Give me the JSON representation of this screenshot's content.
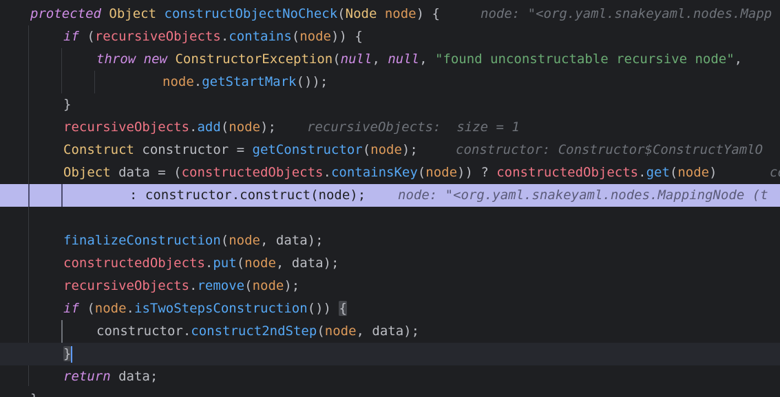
{
  "editor": {
    "lines": [
      {
        "tokens": [
          {
            "t": "protected",
            "c": "tok-kw"
          },
          {
            "t": " "
          },
          {
            "t": "Object",
            "c": "tok-type"
          },
          {
            "t": " "
          },
          {
            "t": "constructObjectNoCheck",
            "c": "tok-method"
          },
          {
            "t": "("
          },
          {
            "t": "Node",
            "c": "tok-type"
          },
          {
            "t": " "
          },
          {
            "t": "node",
            "c": "tok-param"
          },
          {
            "t": ") {"
          }
        ],
        "hint": "node: \"<org.yaml.snakeyaml.nodes.Mapp"
      },
      {
        "tokens": [
          {
            "t": "if",
            "c": "tok-kw"
          },
          {
            "t": " ("
          },
          {
            "t": "recursiveObjects",
            "c": "tok-field"
          },
          {
            "t": "."
          },
          {
            "t": "contains",
            "c": "tok-method"
          },
          {
            "t": "("
          },
          {
            "t": "node",
            "c": "tok-param"
          },
          {
            "t": ")) {"
          }
        ]
      },
      {
        "tokens": [
          {
            "t": "throw",
            "c": "tok-kw"
          },
          {
            "t": " "
          },
          {
            "t": "new",
            "c": "tok-kw"
          },
          {
            "t": " "
          },
          {
            "t": "ConstructorException",
            "c": "tok-type"
          },
          {
            "t": "("
          },
          {
            "t": "null",
            "c": "tok-kw"
          },
          {
            "t": ", "
          },
          {
            "t": "null",
            "c": "tok-kw"
          },
          {
            "t": ", "
          },
          {
            "t": "\"found unconstructable recursive node\"",
            "c": "tok-string"
          },
          {
            "t": ","
          }
        ]
      },
      {
        "tokens": [
          {
            "t": "node",
            "c": "tok-param"
          },
          {
            "t": "."
          },
          {
            "t": "getStartMark",
            "c": "tok-method"
          },
          {
            "t": "());"
          }
        ]
      },
      {
        "tokens": [
          {
            "t": "}"
          }
        ]
      },
      {
        "tokens": [
          {
            "t": "recursiveObjects",
            "c": "tok-field"
          },
          {
            "t": "."
          },
          {
            "t": "add",
            "c": "tok-method"
          },
          {
            "t": "("
          },
          {
            "t": "node",
            "c": "tok-param"
          },
          {
            "t": ");"
          }
        ],
        "hint": "recursiveObjects:  size = 1"
      },
      {
        "tokens": [
          {
            "t": "Construct",
            "c": "tok-type"
          },
          {
            "t": " constructor = "
          },
          {
            "t": "getConstructor",
            "c": "tok-method"
          },
          {
            "t": "("
          },
          {
            "t": "node",
            "c": "tok-param"
          },
          {
            "t": ");"
          }
        ],
        "hint": "constructor: Constructor$ConstructYamlO"
      },
      {
        "tokens": [
          {
            "t": "Object",
            "c": "tok-type"
          },
          {
            "t": " data = ("
          },
          {
            "t": "constructedObjects",
            "c": "tok-field"
          },
          {
            "t": "."
          },
          {
            "t": "containsKey",
            "c": "tok-method"
          },
          {
            "t": "("
          },
          {
            "t": "node",
            "c": "tok-param"
          },
          {
            "t": ")) ? "
          },
          {
            "t": "constructedObjects",
            "c": "tok-field"
          },
          {
            "t": "."
          },
          {
            "t": "get",
            "c": "tok-method"
          },
          {
            "t": "("
          },
          {
            "t": "node",
            "c": "tok-param"
          },
          {
            "t": ")"
          }
        ],
        "hint": "co"
      },
      {
        "tokens": [
          {
            "t": ": constructor.construct(node);"
          }
        ],
        "hint": "node: \"<org.yaml.snakeyaml.nodes.MappingNode (t"
      },
      {
        "tokens": []
      },
      {
        "tokens": [
          {
            "t": "finalizeConstruction",
            "c": "tok-method"
          },
          {
            "t": "("
          },
          {
            "t": "node",
            "c": "tok-param"
          },
          {
            "t": ", data);"
          }
        ]
      },
      {
        "tokens": [
          {
            "t": "constructedObjects",
            "c": "tok-field"
          },
          {
            "t": "."
          },
          {
            "t": "put",
            "c": "tok-method"
          },
          {
            "t": "("
          },
          {
            "t": "node",
            "c": "tok-param"
          },
          {
            "t": ", data);"
          }
        ]
      },
      {
        "tokens": [
          {
            "t": "recursiveObjects",
            "c": "tok-field"
          },
          {
            "t": "."
          },
          {
            "t": "remove",
            "c": "tok-method"
          },
          {
            "t": "("
          },
          {
            "t": "node",
            "c": "tok-param"
          },
          {
            "t": ");"
          }
        ]
      },
      {
        "tokens": [
          {
            "t": "if",
            "c": "tok-kw"
          },
          {
            "t": " ("
          },
          {
            "t": "node",
            "c": "tok-param"
          },
          {
            "t": "."
          },
          {
            "t": "isTwoStepsConstruction",
            "c": "tok-method"
          },
          {
            "t": "()) "
          },
          {
            "t": "{",
            "c": "tok-brace-match"
          }
        ]
      },
      {
        "tokens": [
          {
            "t": "constructor."
          },
          {
            "t": "construct2ndStep",
            "c": "tok-method"
          },
          {
            "t": "("
          },
          {
            "t": "node",
            "c": "tok-param"
          },
          {
            "t": ", data);"
          }
        ]
      },
      {
        "tokens": [
          {
            "t": "}",
            "c": "tok-brace-match"
          }
        ],
        "caret": true
      },
      {
        "tokens": [
          {
            "t": "return",
            "c": "tok-kw"
          },
          {
            "t": " data;"
          }
        ]
      },
      {
        "tokens": [
          {
            "t": "}"
          }
        ]
      }
    ]
  }
}
